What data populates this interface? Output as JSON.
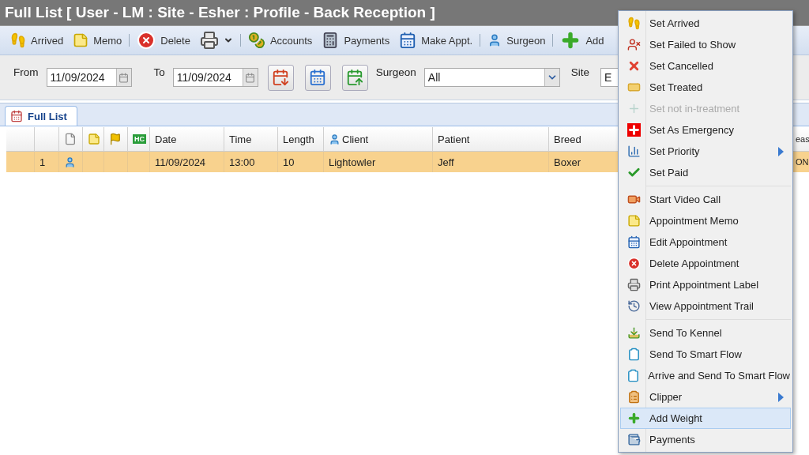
{
  "window": {
    "title": "Full List [ User - LM : Site - Esher : Profile - Back Reception ]"
  },
  "toolbar": [
    {
      "kind": "button",
      "label": "Arrived"
    },
    {
      "kind": "button",
      "label": "Memo"
    },
    {
      "kind": "separator"
    },
    {
      "kind": "button",
      "label": "Delete"
    },
    {
      "kind": "dropdown"
    },
    {
      "kind": "separator"
    },
    {
      "kind": "button",
      "label": "Accounts"
    },
    {
      "kind": "button",
      "label": "Payments"
    },
    {
      "kind": "button",
      "label": "Make Appt."
    },
    {
      "kind": "separator"
    },
    {
      "kind": "button",
      "label": "Surgeon"
    },
    {
      "kind": "separator"
    },
    {
      "kind": "button",
      "label": "Add"
    }
  ],
  "filters": {
    "from_label": "From",
    "from_value": "11/09/2024",
    "to_label": "To",
    "to_value": "11/09/2024",
    "surgeon_label": "Surgeon",
    "surgeon_value": "All",
    "site_label": "Site",
    "site_value": "E"
  },
  "tabs": [
    {
      "label": "Full List",
      "selected": true
    }
  ],
  "table": {
    "columns": [
      "",
      "",
      "",
      "",
      "",
      "HC",
      "Date",
      "Time",
      "Length",
      "Client",
      "Patient",
      "Breed",
      "eas"
    ],
    "rows": [
      {
        "selected": true,
        "cells": [
          "",
          "1",
          "",
          "",
          "",
          "",
          "11/09/2024",
          "13:00",
          "10",
          "Lightowler",
          "Jeff",
          "Boxer",
          "ON"
        ]
      }
    ]
  },
  "context_menu": [
    {
      "kind": "item",
      "label": "Set Arrived",
      "disabled": false,
      "submenu": false,
      "selected": false
    },
    {
      "kind": "item",
      "label": "Set Failed to Show",
      "disabled": false,
      "submenu": false,
      "selected": false
    },
    {
      "kind": "item",
      "label": "Set Cancelled",
      "disabled": false,
      "submenu": false,
      "selected": false
    },
    {
      "kind": "item",
      "label": "Set Treated",
      "disabled": false,
      "submenu": false,
      "selected": false
    },
    {
      "kind": "item",
      "label": "Set not in-treatment",
      "disabled": true,
      "submenu": false,
      "selected": false
    },
    {
      "kind": "item",
      "label": "Set As Emergency",
      "disabled": false,
      "submenu": false,
      "selected": false
    },
    {
      "kind": "item",
      "label": "Set Priority",
      "disabled": false,
      "submenu": true,
      "selected": false
    },
    {
      "kind": "item",
      "label": "Set Paid",
      "disabled": false,
      "submenu": false,
      "selected": false
    },
    {
      "kind": "separator"
    },
    {
      "kind": "item",
      "label": "Start Video Call",
      "disabled": false,
      "submenu": false,
      "selected": false
    },
    {
      "kind": "item",
      "label": "Appointment Memo",
      "disabled": false,
      "submenu": false,
      "selected": false
    },
    {
      "kind": "item",
      "label": "Edit Appointment",
      "disabled": false,
      "submenu": false,
      "selected": false
    },
    {
      "kind": "item",
      "label": "Delete Appointment",
      "disabled": false,
      "submenu": false,
      "selected": false
    },
    {
      "kind": "item",
      "label": "Print Appointment Label",
      "disabled": false,
      "submenu": false,
      "selected": false
    },
    {
      "kind": "item",
      "label": "View Appointment Trail",
      "disabled": false,
      "submenu": false,
      "selected": false
    },
    {
      "kind": "separator"
    },
    {
      "kind": "item",
      "label": "Send To Kennel",
      "disabled": false,
      "submenu": false,
      "selected": false
    },
    {
      "kind": "item",
      "label": "Send To Smart Flow",
      "disabled": false,
      "submenu": false,
      "selected": false
    },
    {
      "kind": "item",
      "label": "Arrive and Send To Smart Flow",
      "disabled": false,
      "submenu": false,
      "selected": false
    },
    {
      "kind": "item",
      "label": "Clipper",
      "disabled": false,
      "submenu": true,
      "selected": false
    },
    {
      "kind": "item",
      "label": "Add Weight",
      "disabled": false,
      "submenu": false,
      "selected": true
    },
    {
      "kind": "item",
      "label": "Payments",
      "disabled": false,
      "submenu": false,
      "selected": false
    }
  ]
}
